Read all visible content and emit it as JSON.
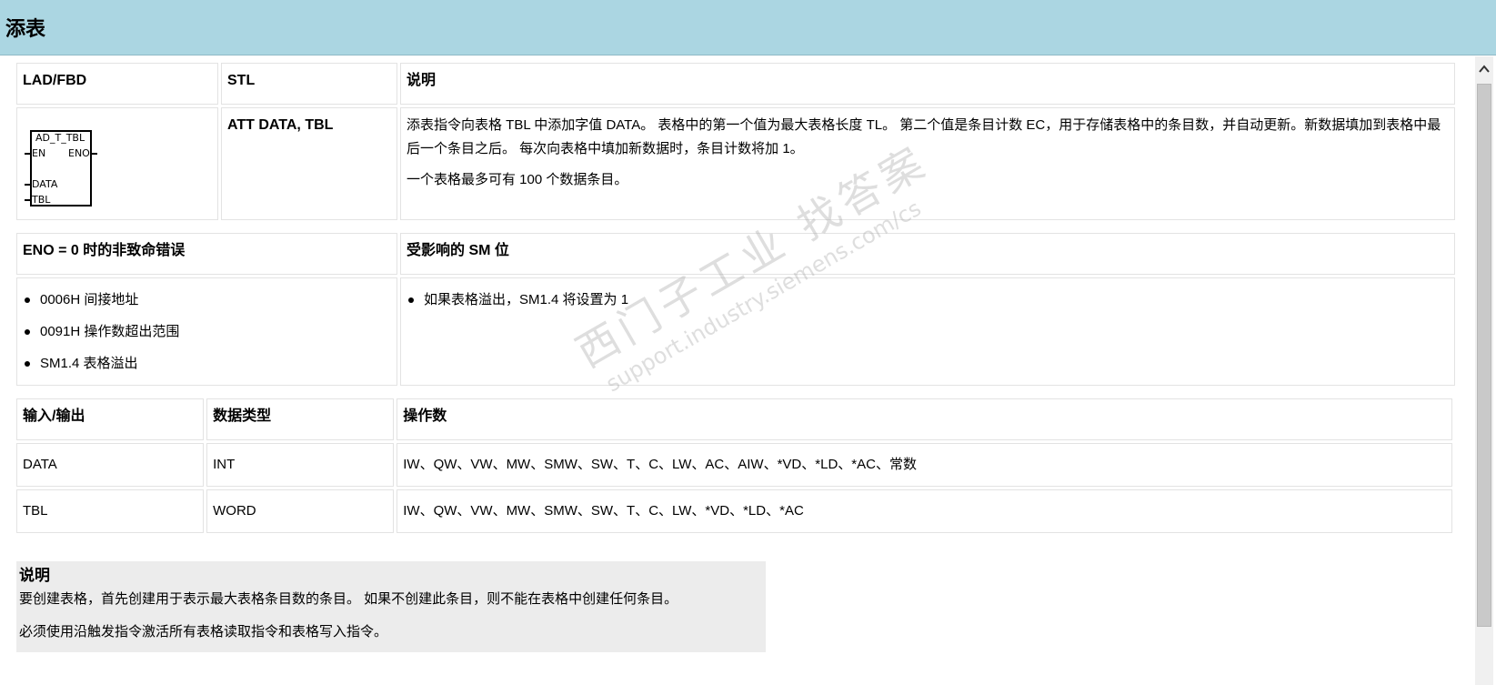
{
  "page": {
    "title": "添表"
  },
  "table1": {
    "headers": [
      "LAD/FBD",
      "STL",
      "说明"
    ],
    "lad": {
      "box_title": "AD_T_TBL",
      "en": "EN",
      "eno": "ENO",
      "data": "DATA",
      "tbl": "TBL"
    },
    "stl": "ATT DATA, TBL",
    "desc": [
      "添表指令向表格 TBL 中添加字值 DATA。 表格中的第一个值为最大表格长度 TL。 第二个值是条目计数 EC，用于存储表格中的条目数，并自动更新。新数据填加到表格中最后一个条目之后。 每次向表格中填加新数据时，条目计数将加 1。",
      "一个表格最多可有 100 个数据条目。"
    ]
  },
  "table2": {
    "headers": [
      "ENO = 0 时的非致命错误",
      "受影响的 SM 位"
    ],
    "errors": [
      "0006H 间接地址",
      "0091H 操作数超出范围",
      "SM1.4 表格溢出"
    ],
    "sm_bits": [
      "如果表格溢出，SM1.4 将设置为 1"
    ]
  },
  "table3": {
    "headers": [
      "输入/输出",
      "数据类型",
      "操作数"
    ],
    "rows": [
      [
        "DATA",
        "INT",
        "IW、QW、VW、MW、SMW、SW、T、C、LW、AC、AIW、*VD、*LD、*AC、常数"
      ],
      [
        "TBL",
        "WORD",
        "IW、QW、VW、MW、SMW、SW、T、C、LW、*VD、*LD、*AC"
      ]
    ]
  },
  "note": {
    "title": "说明",
    "lines": [
      "要创建表格，首先创建用于表示最大表格条目数的条目。 如果不创建此条目，则不能在表格中创建任何条目。",
      "必须使用沿触发指令激活所有表格读取指令和表格写入指令。"
    ]
  },
  "watermark": {
    "line1": "西门子工业  找答案",
    "line2": "support.industry.siemens.com/cs"
  },
  "icons": {
    "scroll_up": "chevron-up-icon"
  }
}
